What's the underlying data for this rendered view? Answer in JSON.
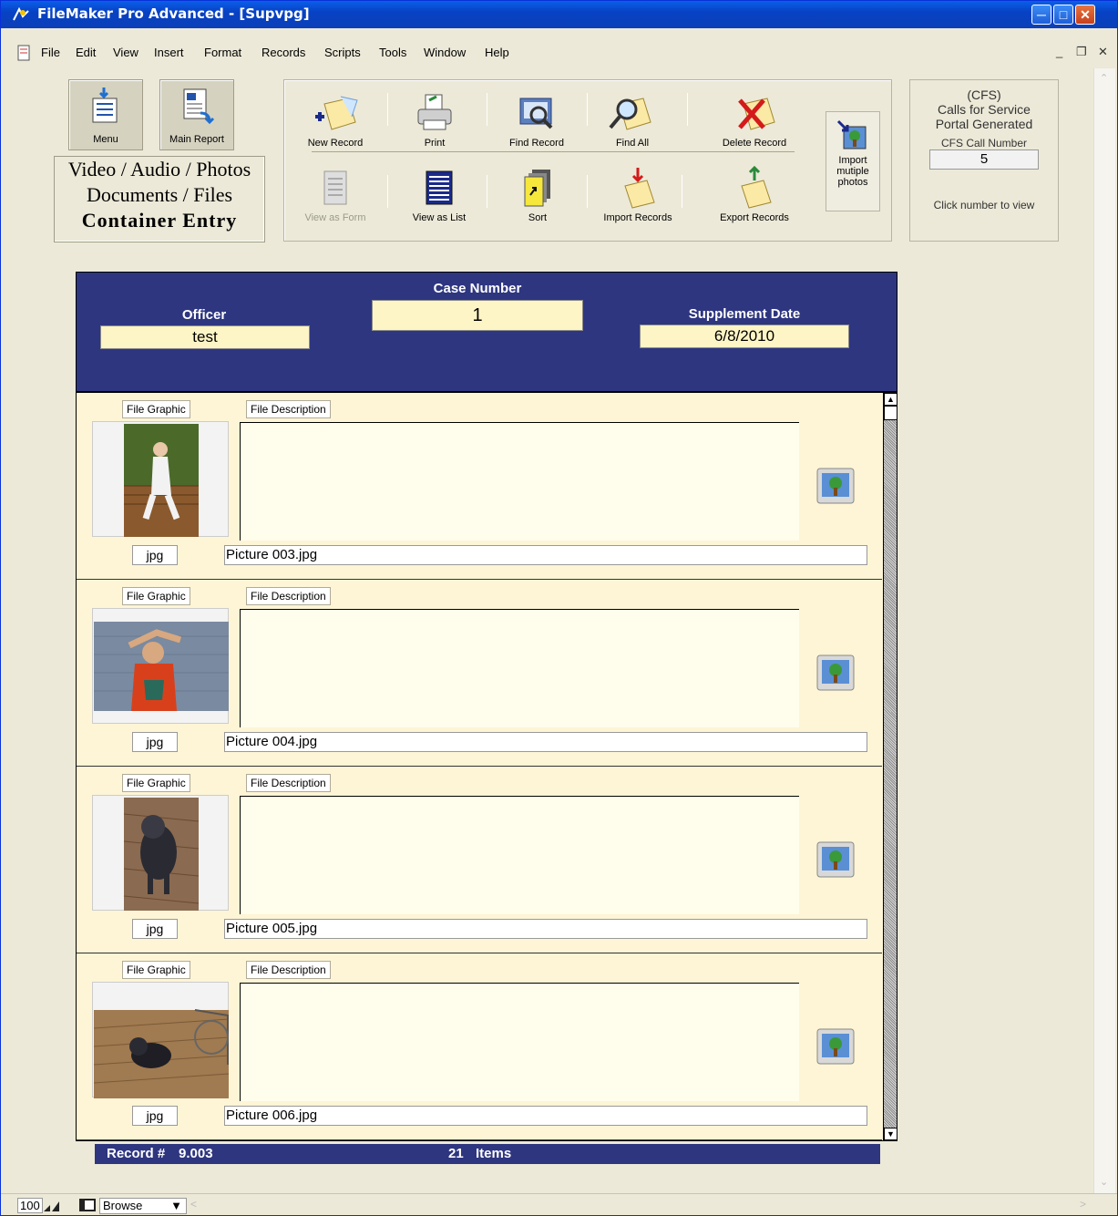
{
  "window": {
    "title": "FileMaker Pro Advanced - [Supvpg]"
  },
  "menu": [
    "File",
    "Edit",
    "View",
    "Insert",
    "Format",
    "Records",
    "Scripts",
    "Tools",
    "Window",
    "Help"
  ],
  "nav": {
    "menu_label": "Menu",
    "main_report_label": "Main Report"
  },
  "container_text": {
    "line1": "Video / Audio / Photos",
    "line2": "Documents / Files",
    "line3": "Container Entry"
  },
  "toolbar": {
    "new_record": "New Record",
    "print": "Print",
    "find_record": "Find Record",
    "find_all": "Find All",
    "delete_record": "Delete Record",
    "view_as_form": "View as Form",
    "view_as_list": "View as List",
    "sort": "Sort",
    "import_records": "Import Records",
    "export_records": "Export Records",
    "import_multiple_1": "Import",
    "import_multiple_2": "mutiple",
    "import_multiple_3": "photos"
  },
  "cfs": {
    "line1": "(CFS)",
    "line2": "Calls for Service",
    "line3": "Portal Generated",
    "label": "CFS Call Number",
    "value": "5",
    "hint": "Click number to view"
  },
  "header": {
    "officer_label": "Officer",
    "officer_value": "test",
    "case_label": "Case Number",
    "case_value": "1",
    "date_label": "Supplement Date",
    "date_value": "6/8/2010"
  },
  "rows": [
    {
      "graphic_label": "File Graphic",
      "desc_label": "File Description",
      "ext": "jpg",
      "filename": "Picture 003.jpg"
    },
    {
      "graphic_label": "File Graphic",
      "desc_label": "File Description",
      "ext": "jpg",
      "filename": "Picture 004.jpg"
    },
    {
      "graphic_label": "File Graphic",
      "desc_label": "File Description",
      "ext": "jpg",
      "filename": "Picture 005.jpg"
    },
    {
      "graphic_label": "File Graphic",
      "desc_label": "File Description",
      "ext": "jpg",
      "filename": "Picture 006.jpg"
    }
  ],
  "status": {
    "record_label": "Record #",
    "record_value": "9.003",
    "items_count": "21",
    "items_label": "Items"
  },
  "bottom": {
    "zoom": "100",
    "mode": "Browse"
  },
  "colors": {
    "header_blue": "#2e3680",
    "field_yellow": "#fdf5c5",
    "portal_bg": "#fdf5d5"
  }
}
